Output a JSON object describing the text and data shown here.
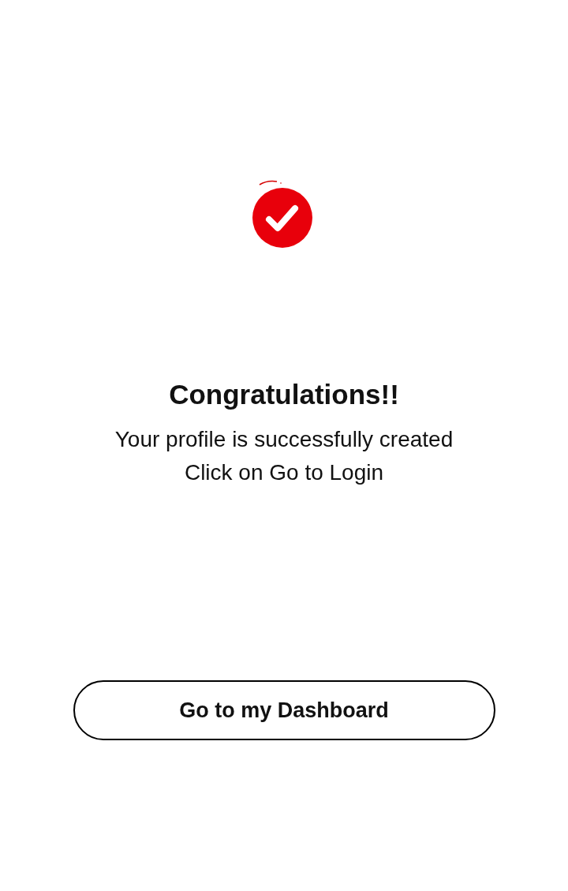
{
  "title": "Congratulations!!",
  "messages": [
    "Your profile is successfully created",
    "Click on Go to Login"
  ],
  "button": {
    "label": "Go to my Dashboard"
  }
}
